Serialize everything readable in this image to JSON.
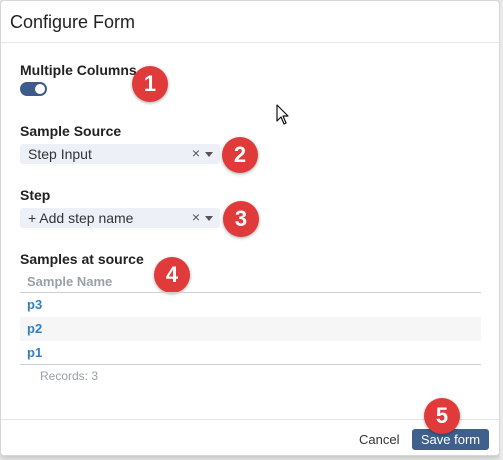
{
  "dialog": {
    "title": "Configure Form"
  },
  "multiple_columns": {
    "label": "Multiple Columns",
    "enabled": true
  },
  "sample_source": {
    "label": "Sample Source",
    "value": "Step Input",
    "clear_icon": "×"
  },
  "step": {
    "label": "Step",
    "value": "+ Add step name",
    "clear_icon": "×"
  },
  "samples_at_source": {
    "label": "Samples at source",
    "column_header": "Sample Name",
    "rows": [
      "p3",
      "p2",
      "p1"
    ],
    "records": "Records: 3"
  },
  "annotations": [
    "1",
    "2",
    "3",
    "4",
    "5"
  ],
  "footer": {
    "cancel_label": "Cancel",
    "save_label": "Save form"
  },
  "colors": {
    "accent": "#3f5f8c",
    "badge": "#e03a3a",
    "link": "#2f7fc1"
  }
}
